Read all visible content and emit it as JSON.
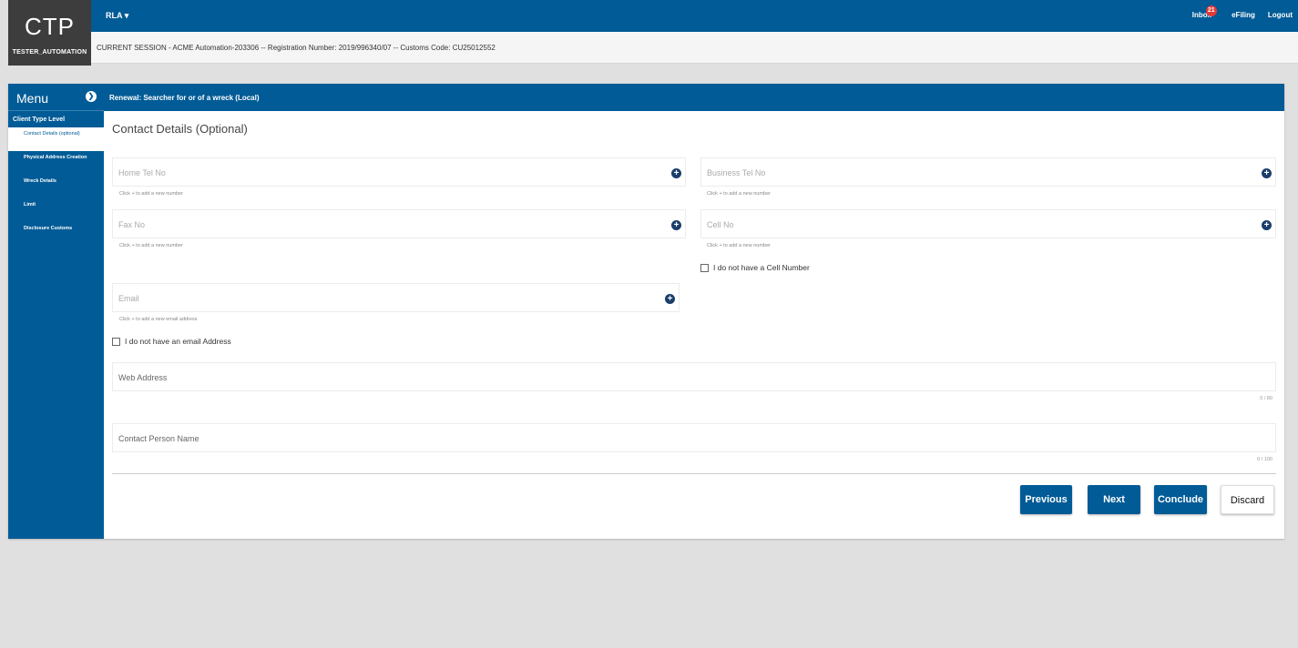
{
  "app": {
    "logo": "CTP",
    "user": "TESTER_AUTOMATION",
    "nav_dropdown": "RLA",
    "inbox_label": "Inbox",
    "inbox_count": "21",
    "efiling_label": "eFiling",
    "logout_label": "Logout"
  },
  "session": {
    "text": "CURRENT SESSION - ACME Automation-203306 -- Registration Number: 2019/996340/07 -- Customs Code: CU25012552"
  },
  "sidebar": {
    "title": "Menu",
    "level": "Client Type Level",
    "items": [
      {
        "label": "Contact Details (optional)"
      },
      {
        "label": "Physical Address Creation"
      },
      {
        "label": "Wreck Details"
      },
      {
        "label": "Limit"
      },
      {
        "label": "Disclosure Customs"
      }
    ]
  },
  "page": {
    "breadcrumb": "Renewal: Searcher for or of a wreck (Local)",
    "section_title": "Contact Details (Optional)"
  },
  "form": {
    "home_tel": {
      "label": "Home Tel No",
      "hint": "Click + to add a new number"
    },
    "business_tel": {
      "label": "Business Tel No",
      "hint": "Click + to add a new number"
    },
    "fax": {
      "label": "Fax No",
      "hint": "Click + to add a new number"
    },
    "cell": {
      "label": "Cell No",
      "hint": "Click + to add a new number"
    },
    "no_cell": "I do not have a Cell Number",
    "email": {
      "label": "Email",
      "hint": "Click + to add a new email address"
    },
    "no_email": "I do not have an email Address",
    "web": {
      "label": "Web Address",
      "counter": "0 / 80"
    },
    "contact_person": {
      "label": "Contact Person Name",
      "counter": "0 / 100"
    }
  },
  "buttons": {
    "previous": "Previous",
    "next": "Next",
    "conclude": "Conclude",
    "discard": "Discard"
  }
}
